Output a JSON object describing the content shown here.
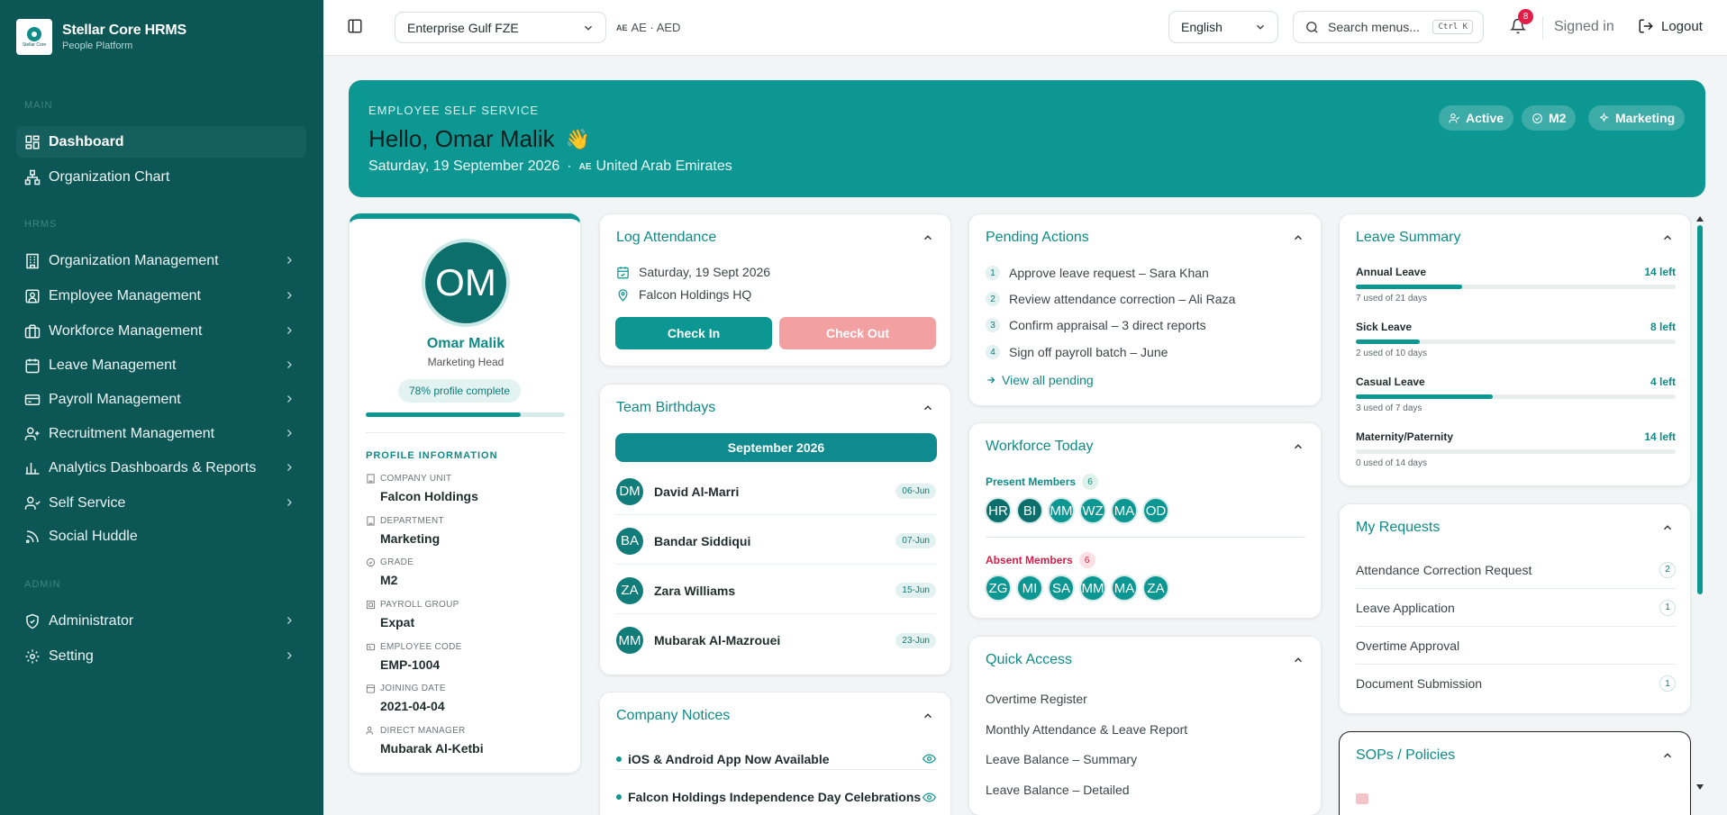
{
  "app": {
    "name": "Stellar Core HRMS",
    "subtitle": "People Platform",
    "logo_text": "Stellar Core"
  },
  "sidebar": {
    "sections": {
      "main": "MAIN",
      "hrms": "HRMS",
      "admin": "ADMIN"
    },
    "items": [
      {
        "label": "Dashboard",
        "icon": "grid-icon"
      },
      {
        "label": "Organization Chart",
        "icon": "org-chart-icon"
      },
      {
        "label": "Organization Management",
        "icon": "building-icon"
      },
      {
        "label": "Employee Management",
        "icon": "id-card-icon"
      },
      {
        "label": "Workforce Management",
        "icon": "briefcase-icon"
      },
      {
        "label": "Leave Management",
        "icon": "calendar-icon"
      },
      {
        "label": "Payroll Management",
        "icon": "payroll-icon"
      },
      {
        "label": "Recruitment Management",
        "icon": "user-plus-icon"
      },
      {
        "label": "Analytics Dashboards & Reports",
        "icon": "bar-chart-icon"
      },
      {
        "label": "Self Service",
        "icon": "user-service-icon"
      },
      {
        "label": "Social Huddle",
        "icon": "rss-icon"
      },
      {
        "label": "Administrator",
        "icon": "shield-icon"
      },
      {
        "label": "Setting",
        "icon": "gear-icon"
      }
    ]
  },
  "topbar": {
    "company": "Enterprise Gulf FZE",
    "region_flag": "AE",
    "region": "AE · AED",
    "language": "English",
    "search_placeholder": "Search menus...",
    "search_kbd": "Ctrl K",
    "notifications": "8",
    "signed_in": "Signed in",
    "logout": "Logout"
  },
  "hero": {
    "eyebrow": "EMPLOYEE SELF SERVICE",
    "greeting": "Hello, Omar Malik",
    "wave": "👋",
    "date": "Saturday, 19 September 2026",
    "sep": "·",
    "country_flag": "AE",
    "country": "United Arab Emirates",
    "pills": [
      "Active",
      "M2",
      "Marketing"
    ]
  },
  "profile": {
    "initials": "OM",
    "name": "Omar Malik",
    "title": "Marketing Head",
    "complete": "78% profile complete",
    "complete_pct": 78,
    "section": "PROFILE INFORMATION",
    "fields": [
      {
        "label": "COMPANY UNIT",
        "value": "Falcon Holdings"
      },
      {
        "label": "DEPARTMENT",
        "value": "Marketing"
      },
      {
        "label": "GRADE",
        "value": "M2"
      },
      {
        "label": "PAYROLL GROUP",
        "value": "Expat"
      },
      {
        "label": "EMPLOYEE CODE",
        "value": "EMP-1004"
      },
      {
        "label": "JOINING DATE",
        "value": "2021-04-04"
      },
      {
        "label": "DIRECT MANAGER",
        "value": "Mubarak Al-Ketbi"
      }
    ]
  },
  "attendance": {
    "title": "Log Attendance",
    "date": "Saturday, 19 Sept 2026",
    "location": "Falcon Holdings HQ",
    "check_in": "Check In",
    "check_out": "Check Out"
  },
  "birthdays": {
    "title": "Team Birthdays",
    "month": "September 2026",
    "people": [
      {
        "initials": "DM",
        "name": "David Al-Marri",
        "date": "06-Jun"
      },
      {
        "initials": "BA",
        "name": "Bandar Siddiqui",
        "date": "07-Jun"
      },
      {
        "initials": "ZA",
        "name": "Zara Williams",
        "date": "15-Jun"
      },
      {
        "initials": "MM",
        "name": "Mubarak Al-Mazrouei",
        "date": "23-Jun"
      }
    ]
  },
  "notices": {
    "title": "Company Notices",
    "items": [
      "iOS & Android App Now Available",
      "Falcon Holdings Independence Day Celebrations"
    ]
  },
  "pending": {
    "title": "Pending Actions",
    "items": [
      "Approve leave request – Sara Khan",
      "Review attendance correction – Ali Raza",
      "Confirm appraisal – 3 direct reports",
      "Sign off payroll batch – June"
    ],
    "view_all": "View all pending"
  },
  "workforce": {
    "title": "Workforce Today",
    "present_label": "Present Members",
    "present_count": "6",
    "present": [
      "HR",
      "BI",
      "MM",
      "WZ",
      "MA",
      "OD"
    ],
    "absent_label": "Absent Members",
    "absent_count": "6",
    "absent": [
      "ZG",
      "MI",
      "SA",
      "MM",
      "MA",
      "ZA"
    ]
  },
  "quick": {
    "title": "Quick Access",
    "items": [
      "Overtime Register",
      "Monthly Attendance & Leave Report",
      "Leave Balance – Summary",
      "Leave Balance – Detailed"
    ]
  },
  "leave": {
    "title": "Leave Summary",
    "items": [
      {
        "name": "Annual Leave",
        "left": "14 left",
        "used": "7 used of 21 days",
        "fraction": 0.333
      },
      {
        "name": "Sick Leave",
        "left": "8 left",
        "used": "2 used of 10 days",
        "fraction": 0.2
      },
      {
        "name": "Casual Leave",
        "left": "4 left",
        "used": "3 used of 7 days",
        "fraction": 0.429
      },
      {
        "name": "Maternity/Paternity",
        "left": "14 left",
        "used": "0 used of 14 days",
        "fraction": 0
      }
    ]
  },
  "requests": {
    "title": "My Requests",
    "items": [
      {
        "label": "Attendance Correction Request",
        "count": "2"
      },
      {
        "label": "Leave Application",
        "count": "1"
      },
      {
        "label": "Overtime Approval",
        "count": ""
      },
      {
        "label": "Document Submission",
        "count": "1"
      }
    ]
  },
  "sops": {
    "title": "SOPs / Policies"
  },
  "colors": {
    "sidebar": "#0d5656",
    "accent": "#0d9792",
    "danger_soft": "#f3a0a3",
    "badge": "#e11d48"
  }
}
